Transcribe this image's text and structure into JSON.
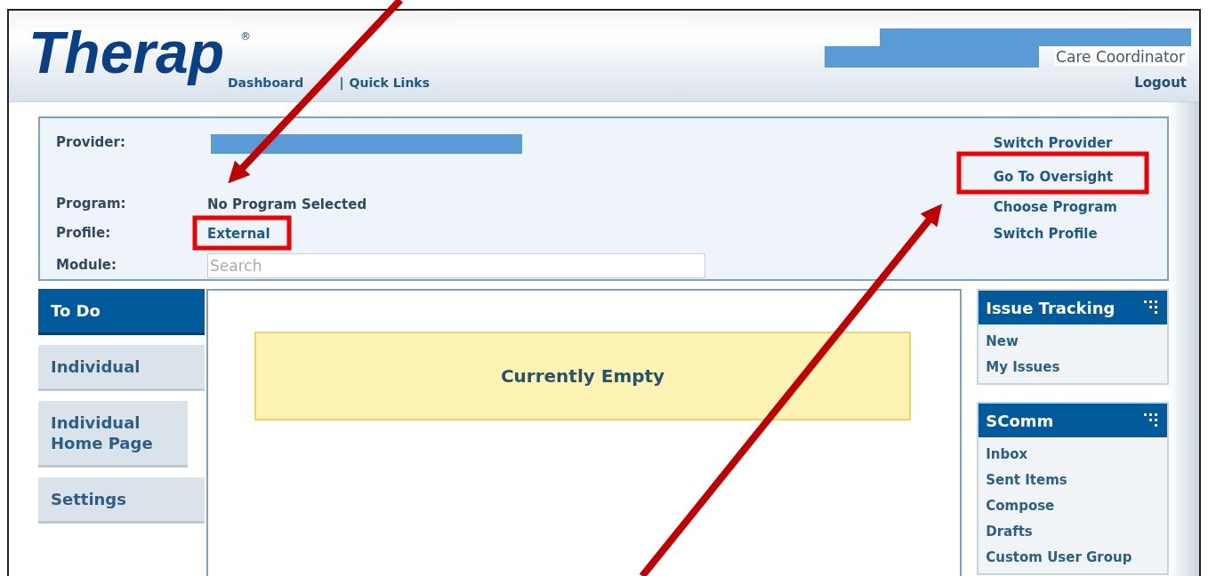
{
  "header": {
    "logo": "Therap",
    "logo_mark": "®",
    "nav_links": [
      "Dashboard",
      "Quick Links"
    ],
    "nav_separator": "|",
    "user_role": "Care Coordinator",
    "logout": "Logout"
  },
  "info": {
    "fields": [
      {
        "label": "Provider:",
        "kind": "redacted"
      },
      {
        "label": "Program:",
        "kind": "text",
        "value": "No Program Selected"
      },
      {
        "label": "Profile:",
        "kind": "link",
        "value": "External"
      },
      {
        "label": "Module:",
        "kind": "search",
        "placeholder": "Search"
      }
    ],
    "actions": [
      "Switch Provider",
      "Go To Oversight",
      "Choose Program",
      "Switch Profile"
    ]
  },
  "nav": [
    {
      "label": "To Do",
      "selected": true
    },
    {
      "label": "Individual",
      "selected": false
    },
    {
      "label": "Individual Home Page",
      "selected": false
    },
    {
      "label": "Settings",
      "selected": false
    }
  ],
  "main": {
    "message": "Currently Empty"
  },
  "widgets": [
    {
      "title": "Issue Tracking",
      "links": [
        "New",
        "My Issues"
      ]
    },
    {
      "title": "SComm",
      "links": [
        "Inbox",
        "Sent Items",
        "Compose",
        "Drafts",
        "Custom User Group"
      ]
    }
  ]
}
